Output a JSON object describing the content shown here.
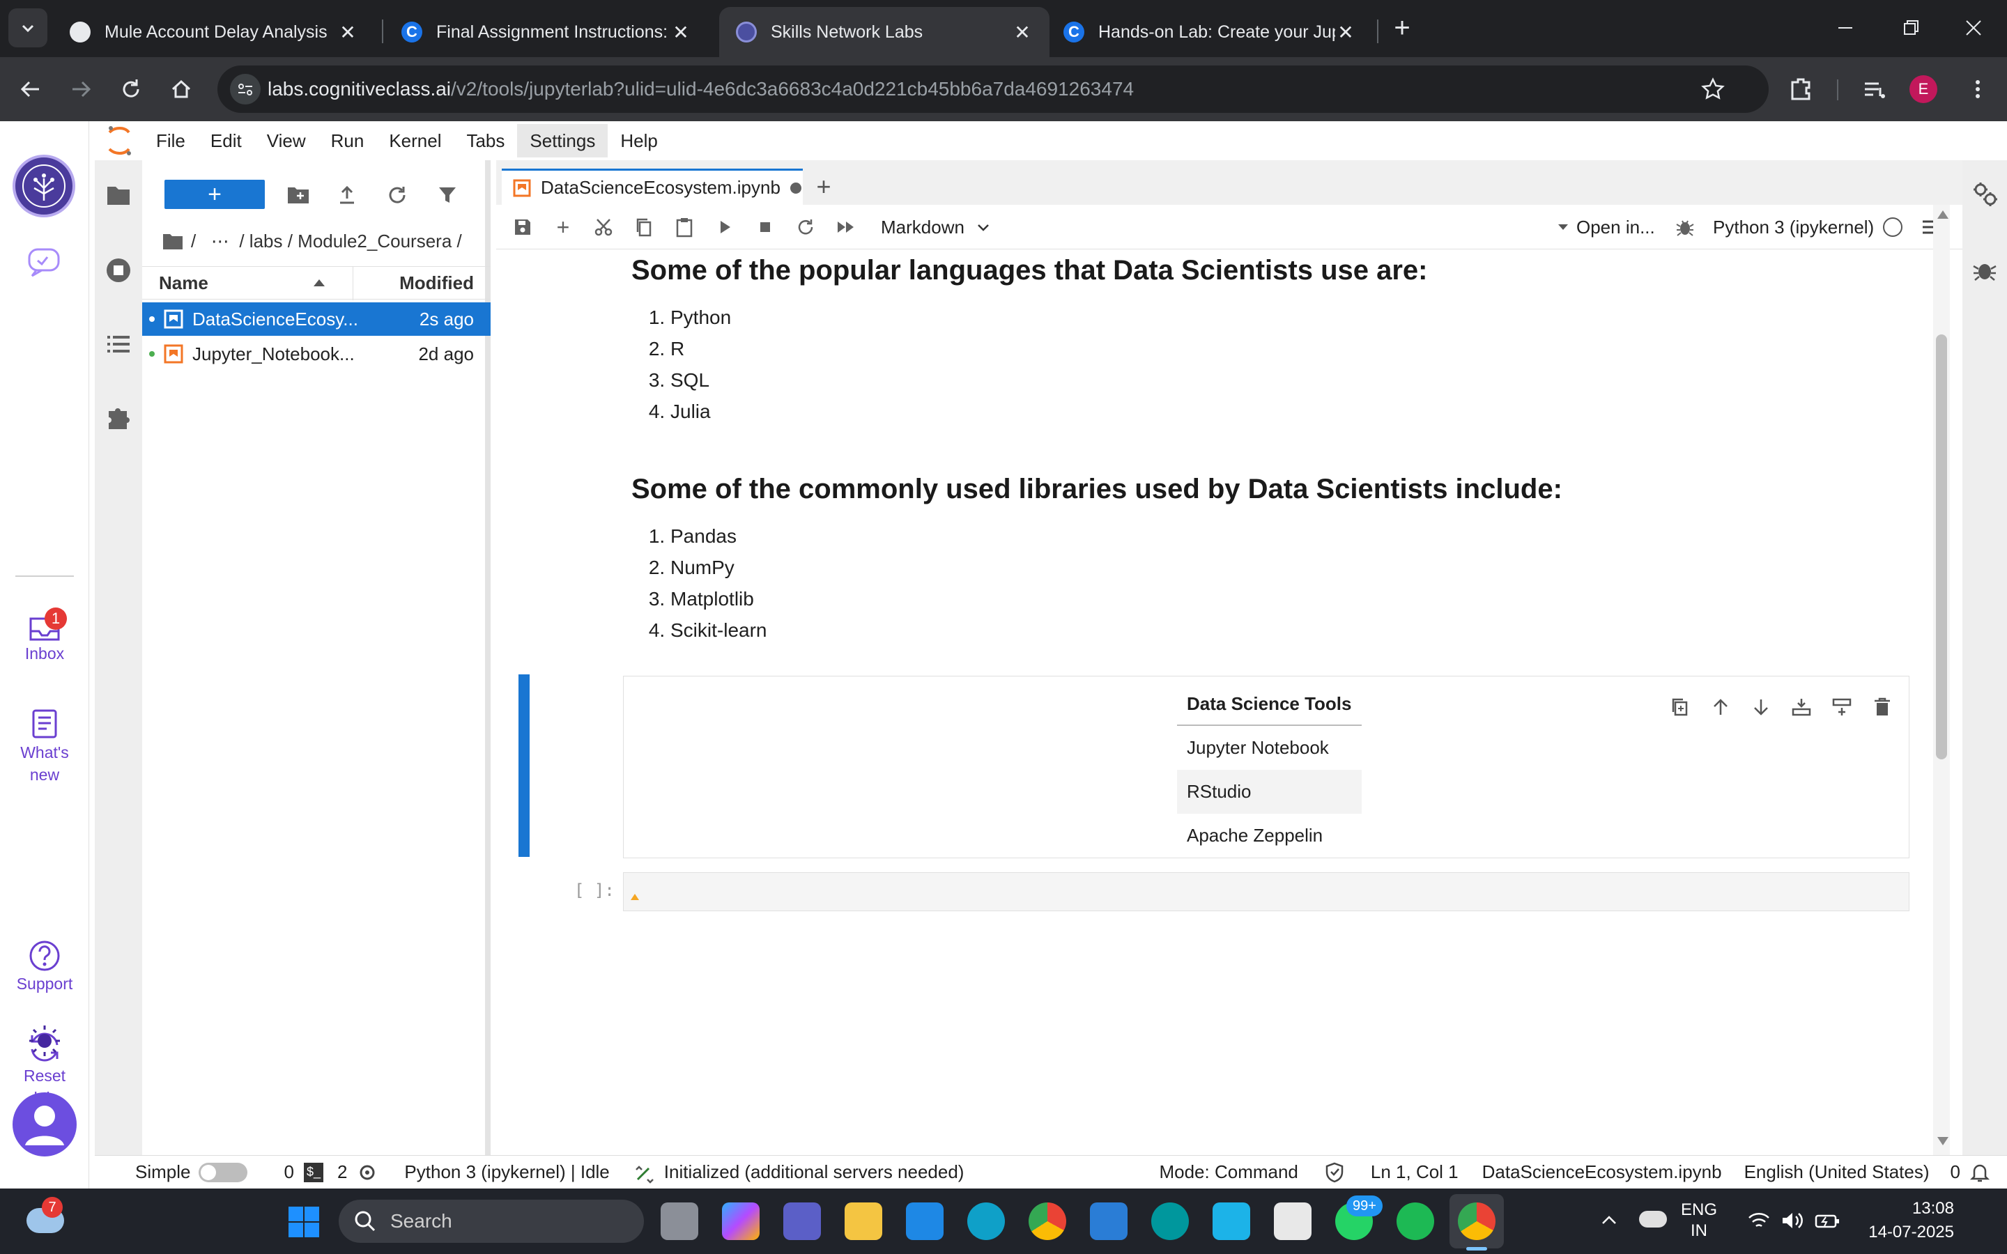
{
  "browser": {
    "tabs": [
      {
        "title": "Mule Account Delay Analysis",
        "active": false
      },
      {
        "title": "Final Assignment Instructions: C",
        "active": false
      },
      {
        "title": "Skills Network Labs",
        "active": true
      },
      {
        "title": "Hands-on Lab: Create your Jupy",
        "active": false
      }
    ],
    "url_host": "labs.cognitiveclass.ai",
    "url_path": "/v2/tools/jupyterlab?ulid=ulid-4e6dc3a6683c4a0d221cb45bb6a7da4691263474",
    "profile_initial": "E"
  },
  "sidebar": {
    "inbox_badge": "1",
    "inbox_label": "Inbox",
    "whats_new_label": "What's new",
    "support_label": "Support",
    "reset_label": "Reset lab"
  },
  "menu": [
    "File",
    "Edit",
    "View",
    "Run",
    "Kernel",
    "Tabs",
    "Settings",
    "Help"
  ],
  "filebrowser": {
    "breadcrumb": "/   ⋯  / labs / Module2_Coursera /",
    "col_name": "Name",
    "col_modified": "Modified",
    "files": [
      {
        "name": "DataScienceEcosy...",
        "modified": "2s ago",
        "selected": true
      },
      {
        "name": "Jupyter_Notebook...",
        "modified": "2d ago",
        "selected": false
      }
    ]
  },
  "notebook": {
    "tab_title": "DataScienceEcosystem.ipynb",
    "cell_type": "Markdown",
    "open_in": "Open in...",
    "kernel": "Python 3 (ipykernel)",
    "languages_heading": "Some of the popular languages that Data Scientists use are:",
    "languages": [
      "Python",
      "R",
      "SQL",
      "Julia"
    ],
    "libraries_heading": "Some of the commonly used libraries used by Data Scientists include:",
    "libraries": [
      "Pandas",
      "NumPy",
      "Matplotlib",
      "Scikit-learn"
    ],
    "table_header": "Data Science Tools",
    "table_rows": [
      "Jupyter Notebook",
      "RStudio",
      "Apache Zeppelin"
    ],
    "prompt": "[ ]:"
  },
  "status": {
    "mode_label": "Simple",
    "count0": "0",
    "count2": "2",
    "kernel_status": "Python 3 (ipykernel) | Idle",
    "init": "Initialized (additional servers needed)",
    "mode": "Mode: Command",
    "position": "Ln 1, Col 1",
    "filename": "DataScienceEcosystem.ipynb",
    "language": "English (United States)",
    "notifications": "0"
  },
  "taskbar": {
    "search": "Search",
    "weather_badge": "7",
    "whatsapp_badge": "99+",
    "lang1": "ENG",
    "lang2": "IN",
    "time": "13:08",
    "date": "14-07-2025"
  },
  "colors": {
    "accent": "#1976d2",
    "sidebar_purple": "#6a3fd0",
    "jupyter_orange": "#f37626"
  }
}
